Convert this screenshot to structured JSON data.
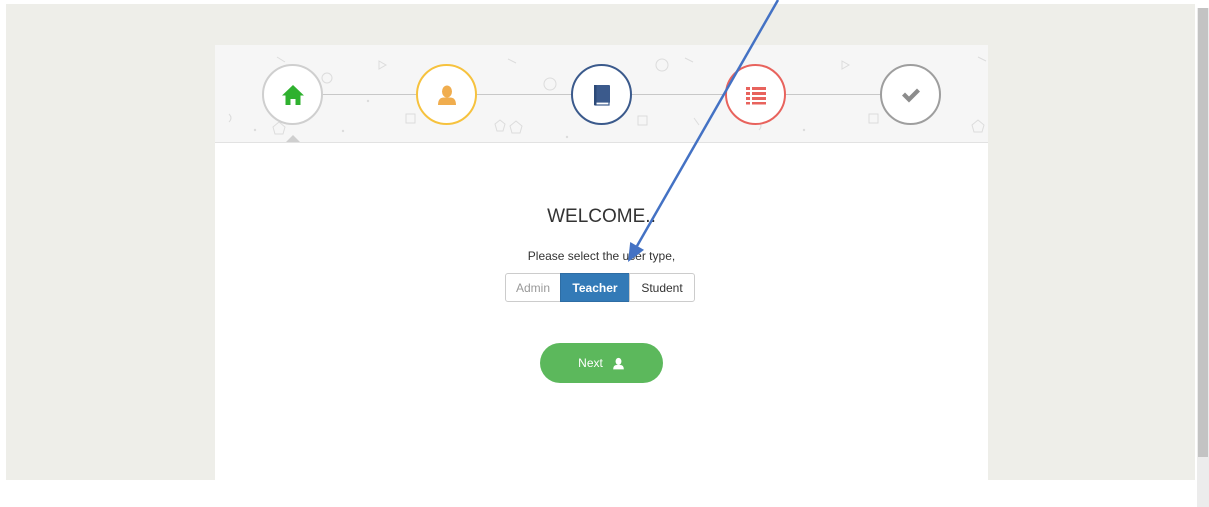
{
  "steps": [
    {
      "name": "home",
      "icon": "home-icon",
      "color": "#cfcfcf",
      "icon_color": "#2fb12f",
      "active": true
    },
    {
      "name": "profile",
      "icon": "user-icon",
      "color": "#f6c23e",
      "icon_color": "#f0ad4e"
    },
    {
      "name": "book",
      "icon": "book-icon",
      "color": "#3b5a8c",
      "icon_color": "#3b5a8c"
    },
    {
      "name": "list",
      "icon": "list-icon",
      "color": "#e8635d",
      "icon_color": "#e8635d"
    },
    {
      "name": "done",
      "icon": "check-icon",
      "color": "#9e9e9e",
      "icon_color": "#8c8c8c"
    }
  ],
  "main": {
    "title": "WELCOME..",
    "prompt": "Please select the user type,",
    "user_types": [
      "Admin",
      "Teacher",
      "Student"
    ],
    "selected_user_type": "Teacher",
    "next_label": "Next"
  },
  "colors": {
    "selected": "#337ab7",
    "next_button": "#5cb85c",
    "annotation_arrow": "#4472c4"
  }
}
